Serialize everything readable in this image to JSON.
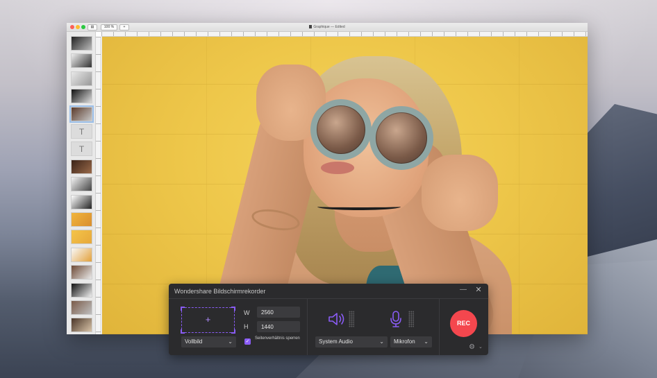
{
  "app_window": {
    "title": "Graphique — Edited",
    "zoom_label": "100 %",
    "add_label": "+",
    "thumbnails": [
      {
        "kind": "image",
        "colors": [
          "#222",
          "#bbb"
        ]
      },
      {
        "kind": "image",
        "colors": [
          "#eee",
          "#333"
        ]
      },
      {
        "kind": "image",
        "colors": [
          "#e8e8e8",
          "#999"
        ]
      },
      {
        "kind": "image",
        "colors": [
          "#111",
          "#ddd"
        ]
      },
      {
        "kind": "image",
        "colors": [
          "#5b3a2a",
          "#c7c7c7"
        ],
        "selected": true
      },
      {
        "kind": "text",
        "glyph": "T"
      },
      {
        "kind": "text",
        "glyph": "T"
      },
      {
        "kind": "image",
        "colors": [
          "#3a2318",
          "#9a6a4a"
        ]
      },
      {
        "kind": "image",
        "colors": [
          "#f2f2f2",
          "#444"
        ]
      },
      {
        "kind": "image",
        "colors": [
          "#fff",
          "#222"
        ]
      },
      {
        "kind": "image",
        "colors": [
          "#f1b53c",
          "#d98e2e"
        ]
      },
      {
        "kind": "image",
        "colors": [
          "#f4c44a",
          "#e7a83a"
        ]
      },
      {
        "kind": "image",
        "colors": [
          "#f8f8f8",
          "#e3a13b"
        ]
      },
      {
        "kind": "image",
        "colors": [
          "#6d4a36",
          "#e9e9e9"
        ]
      },
      {
        "kind": "image",
        "colors": [
          "#111",
          "#eee"
        ]
      },
      {
        "kind": "image",
        "colors": [
          "#7a5b49",
          "#bfbfbf"
        ]
      },
      {
        "kind": "image",
        "colors": [
          "#4a3528",
          "#d8c4a8"
        ]
      }
    ]
  },
  "recorder": {
    "title": "Wondershare Bildschirmrekorder",
    "minimize_label": "—",
    "close_label": "✕",
    "area_plus": "+",
    "mode": "Vollbild",
    "width_label": "W",
    "height_label": "H",
    "width_value": "2560",
    "height_value": "1440",
    "lock_aspect_label": "Seitenverhältnis sperren",
    "lock_aspect_checked": true,
    "system_audio": "System Audio",
    "microphone": "Mikrofon",
    "rec_label": "REC",
    "accent_color": "#8a5cf6",
    "rec_color": "#f4474e"
  }
}
